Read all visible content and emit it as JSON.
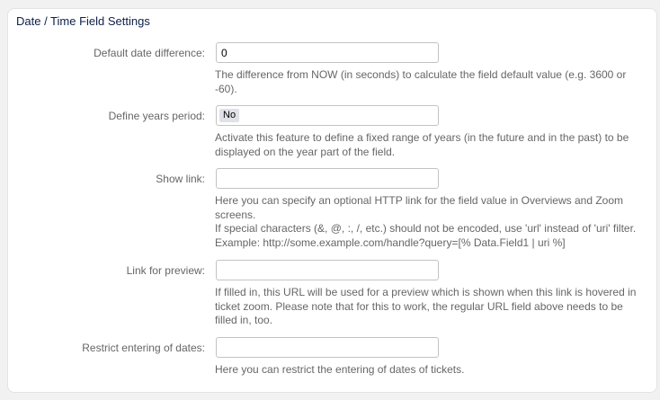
{
  "panel": {
    "title": "Date / Time Field Settings"
  },
  "fields": {
    "default_date_difference": {
      "label": "Default date difference:",
      "value": "0",
      "description": "The difference from NOW (in seconds) to calculate the field default value (e.g. 3600 or -60)."
    },
    "define_years_period": {
      "label": "Define years period:",
      "selected": "No",
      "description": "Activate this feature to define a fixed range of years (in the future and in the past) to be displayed on the year part of the field."
    },
    "show_link": {
      "label": "Show link:",
      "value": "",
      "description_1": "Here you can specify an optional HTTP link for the field value in Overviews and Zoom screens.",
      "description_2": "If special characters (&, @, :, /, etc.) should not be encoded, use 'url' instead of 'uri' filter.",
      "description_3": "Example: http://some.example.com/handle?query=[% Data.Field1 | uri %]"
    },
    "link_for_preview": {
      "label": "Link for preview:",
      "value": "",
      "description": "If filled in, this URL will be used for a preview which is shown when this link is hovered in ticket zoom. Please note that for this to work, the regular URL field above needs to be filled in, too."
    },
    "restrict_entering_of_dates": {
      "label": "Restrict entering of dates:",
      "value": "",
      "description": "Here you can restrict the entering of dates of tickets."
    }
  }
}
